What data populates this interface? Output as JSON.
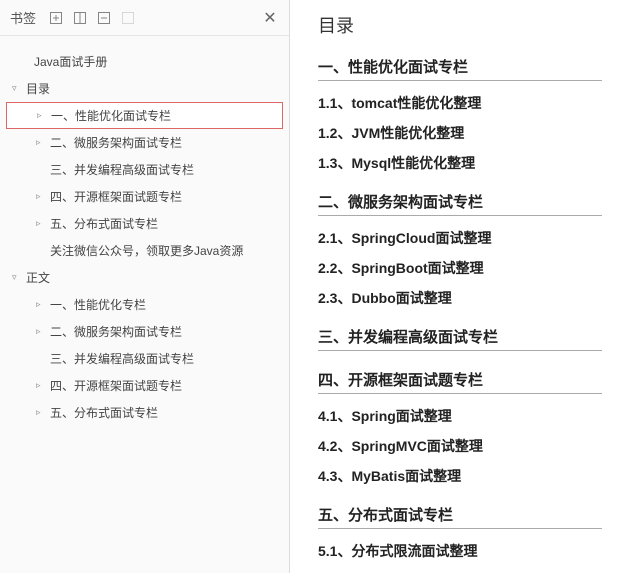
{
  "sidebar": {
    "title": "书签",
    "icons": [
      "expand-icon",
      "collapse-icon",
      "bookmark-icon",
      "tag-icon"
    ],
    "tree": [
      {
        "level": 0,
        "arrow": "",
        "label": "Java面试手册"
      },
      {
        "level": 1,
        "arrow": "▿",
        "label": "目录"
      },
      {
        "level": 2,
        "arrow": "▹",
        "label": "一、性能优化面试专栏",
        "selected": true
      },
      {
        "level": 2,
        "arrow": "▹",
        "label": "二、微服务架构面试专栏"
      },
      {
        "level": 2,
        "arrow": "",
        "label": "三、并发编程高级面试专栏"
      },
      {
        "level": 2,
        "arrow": "▹",
        "label": "四、开源框架面试题专栏"
      },
      {
        "level": 2,
        "arrow": "▹",
        "label": "五、分布式面试专栏"
      },
      {
        "level": 2,
        "arrow": "",
        "label": "关注微信公众号，领取更多Java资源"
      },
      {
        "level": 1,
        "arrow": "▿",
        "label": "正文"
      },
      {
        "level": 2,
        "arrow": "▹",
        "label": "一、性能优化专栏"
      },
      {
        "level": 2,
        "arrow": "▹",
        "label": "二、微服务架构面试专栏"
      },
      {
        "level": 2,
        "arrow": "",
        "label": "三、并发编程高级面试专栏"
      },
      {
        "level": 2,
        "arrow": "▹",
        "label": "四、开源框架面试题专栏"
      },
      {
        "level": 2,
        "arrow": "▹",
        "label": "五、分布式面试专栏"
      }
    ]
  },
  "content": {
    "title": "目录",
    "blocks": [
      {
        "type": "section",
        "text": "一、性能优化面试专栏",
        "first": true
      },
      {
        "type": "sub",
        "text": "1.1、tomcat性能优化整理"
      },
      {
        "type": "sub",
        "text": "1.2、JVM性能优化整理"
      },
      {
        "type": "sub",
        "text": "1.3、Mysql性能优化整理"
      },
      {
        "type": "section",
        "text": "二、微服务架构面试专栏"
      },
      {
        "type": "sub",
        "text": "2.1、SpringCloud面试整理"
      },
      {
        "type": "sub",
        "text": "2.2、SpringBoot面试整理"
      },
      {
        "type": "sub",
        "text": "2.3、Dubbo面试整理"
      },
      {
        "type": "section",
        "text": "三、并发编程高级面试专栏"
      },
      {
        "type": "section",
        "text": "四、开源框架面试题专栏"
      },
      {
        "type": "sub",
        "text": "4.1、Spring面试整理"
      },
      {
        "type": "sub",
        "text": "4.2、SpringMVC面试整理"
      },
      {
        "type": "sub",
        "text": "4.3、MyBatis面试整理"
      },
      {
        "type": "section",
        "text": "五、分布式面试专栏"
      },
      {
        "type": "sub",
        "text": "5.1、分布式限流面试整理"
      }
    ]
  }
}
